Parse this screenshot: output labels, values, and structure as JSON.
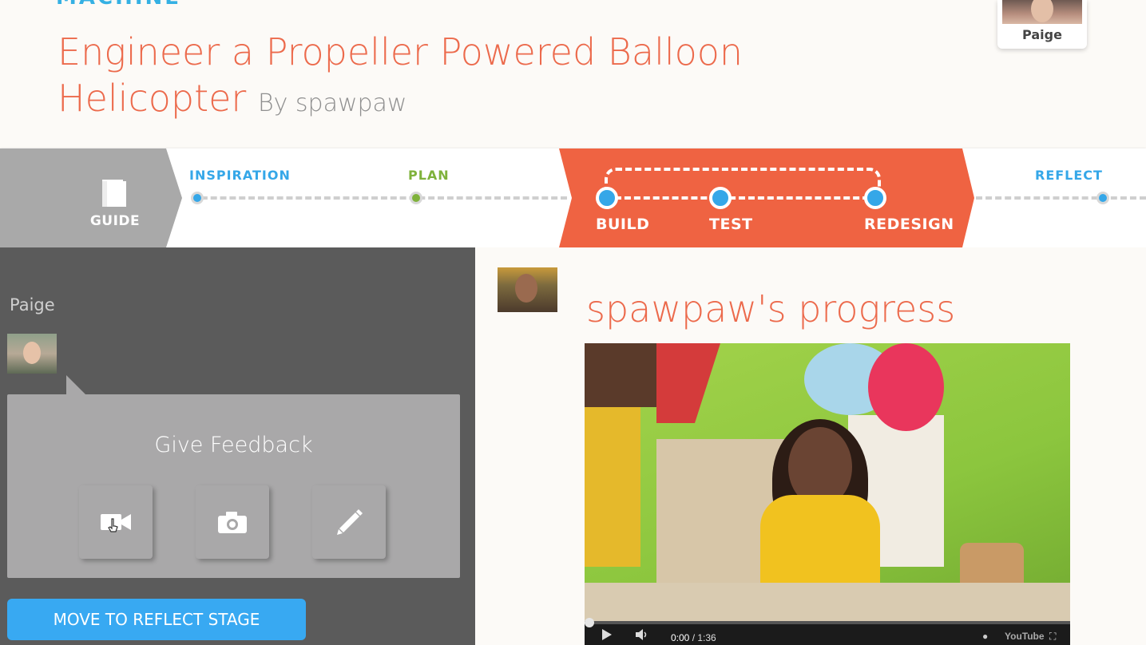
{
  "header": {
    "brand": "MACHINE",
    "title": "Engineer a Propeller Powered Balloon Helicopter",
    "byline": "By spawpaw",
    "user_name": "Paige"
  },
  "stages": {
    "guide_label": "GUIDE",
    "inspiration": "INSPIRATION",
    "plan": "PLAN",
    "build": "BUILD",
    "test": "TEST",
    "redesign": "REDESIGN",
    "reflect": "REFLECT",
    "colors": {
      "inspiration": "#35a7e8",
      "plan": "#7fb23b",
      "active": "#ef6342",
      "reflect": "#35a7e8"
    }
  },
  "feedback": {
    "reviewer_name": "Paige",
    "title": "Give Feedback",
    "buttons": [
      "video-camera-icon",
      "camera-icon",
      "pencil-icon"
    ],
    "move_button": "MOVE TO REFLECT STAGE"
  },
  "progress": {
    "title": "spawpaw's progress",
    "video": {
      "current_time": "0:00",
      "duration": "/ 1:36",
      "brand": "YouTube"
    }
  }
}
